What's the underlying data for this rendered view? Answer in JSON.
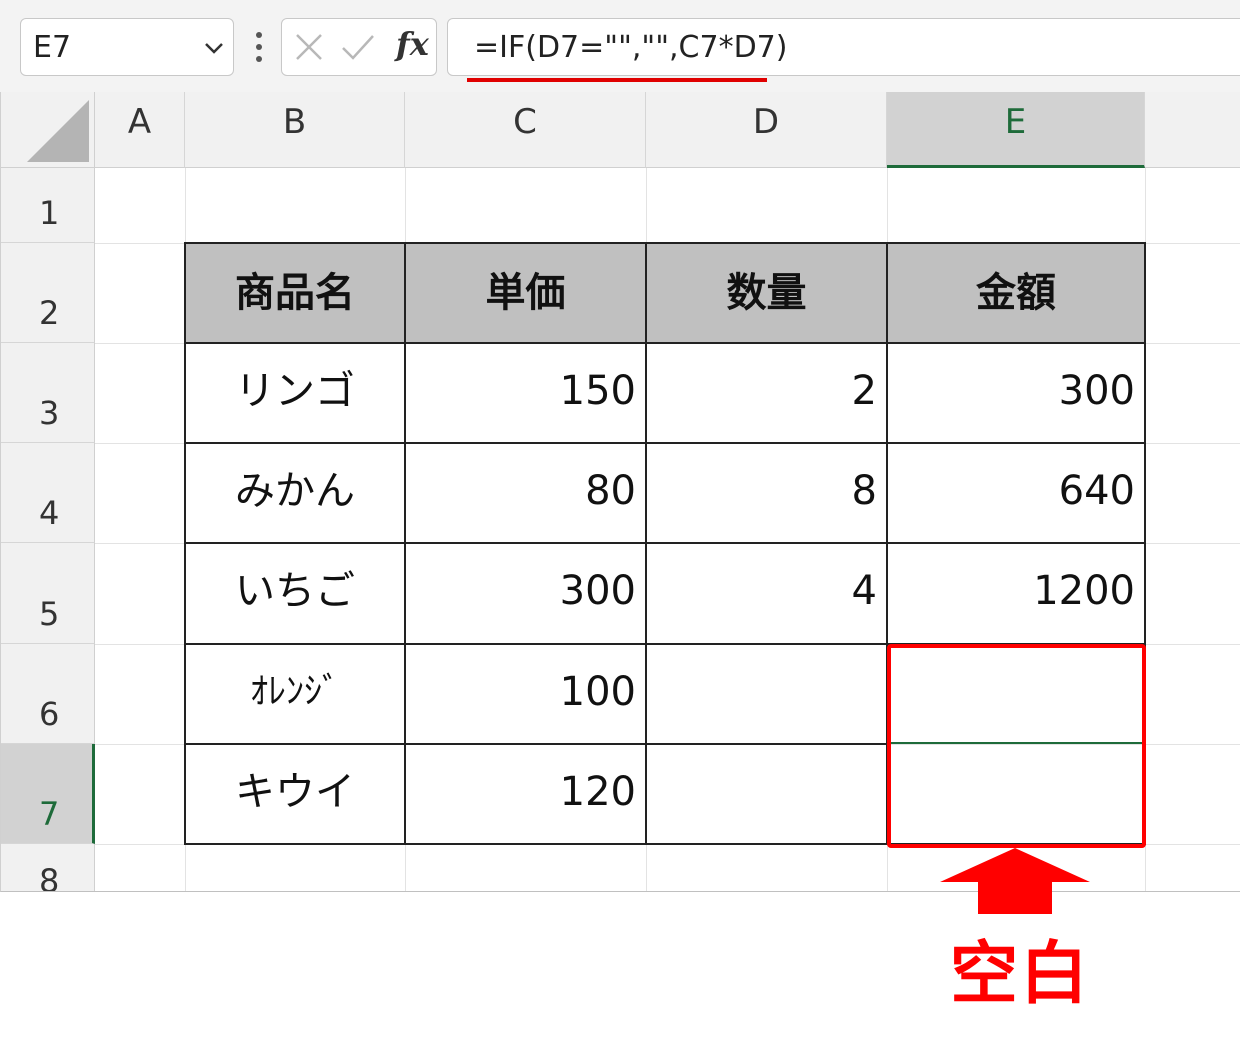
{
  "name_box": {
    "value": "E7"
  },
  "formula_bar": {
    "fx_label": "fx",
    "formula": "=IF(D7=\"\",\"\",C7*D7)"
  },
  "columns": [
    "A",
    "B",
    "C",
    "D",
    "E"
  ],
  "rows": [
    "1",
    "2",
    "3",
    "4",
    "5",
    "6",
    "7",
    "8"
  ],
  "active_cell": {
    "column": "E",
    "row": "7"
  },
  "table": {
    "headers": [
      "商品名",
      "単価",
      "数量",
      "金額"
    ],
    "rows": [
      {
        "name": "リンゴ",
        "price": "150",
        "qty": "2",
        "amount": "300"
      },
      {
        "name": "みかん",
        "price": "80",
        "qty": "8",
        "amount": "640"
      },
      {
        "name": "いちご",
        "price": "300",
        "qty": "4",
        "amount": "1200"
      },
      {
        "name": "ｵﾚﾝｼﾞ",
        "price": "100",
        "qty": "",
        "amount": ""
      },
      {
        "name": "キウイ",
        "price": "120",
        "qty": "",
        "amount": ""
      }
    ]
  },
  "annotation": {
    "label": "空白",
    "color": "#ff0000"
  },
  "colors": {
    "accent_green": "#1e6b3a",
    "header_fill": "#c0c0c0",
    "highlight_red": "#ff0000"
  }
}
